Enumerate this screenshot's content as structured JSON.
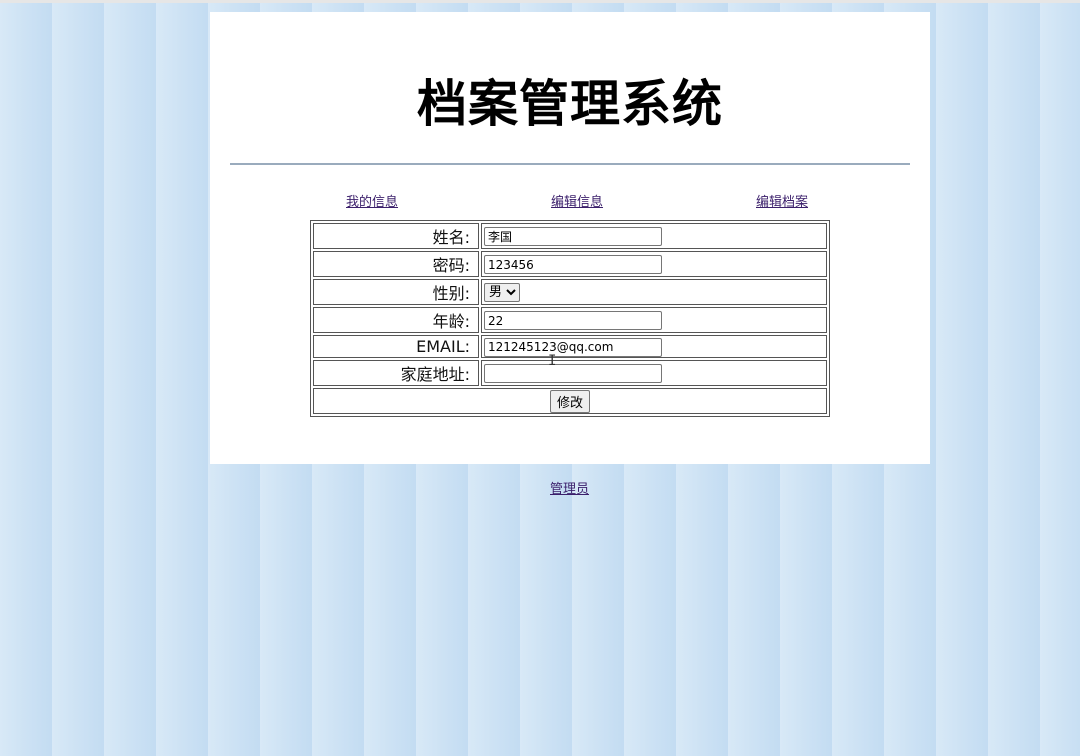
{
  "page": {
    "title": "档案管理系统"
  },
  "nav": {
    "items": [
      {
        "label": "我的信息"
      },
      {
        "label": "编辑信息"
      },
      {
        "label": "编辑档案"
      }
    ]
  },
  "form": {
    "name_label": "姓名:",
    "name_value": "李国",
    "password_label": "密码:",
    "password_value": "123456",
    "gender_label": "性别:",
    "gender_value": "男",
    "age_label": "年龄:",
    "age_value": "22",
    "email_label": "EMAIL:",
    "email_value": "121245123@qq.com",
    "address_label": "家庭地址:",
    "address_value": "",
    "submit_label": "修改"
  },
  "footer": {
    "admin_link": "管理员"
  },
  "colors": {
    "background": "#cfe3f4",
    "link": "#3b1f6b",
    "divider": "#9aabbd"
  },
  "icons": {
    "cursor": "text-cursor-icon"
  }
}
